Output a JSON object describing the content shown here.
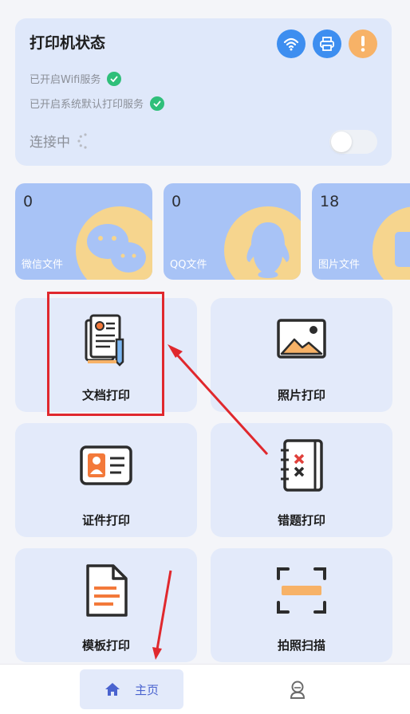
{
  "status": {
    "title": "打印机状态",
    "wifi_service": "已开启Wifi服务",
    "default_print_service": "已开启系统默认打印服务",
    "connecting": "连接中",
    "icons": [
      "wifi-icon",
      "printer-icon",
      "warning-icon"
    ],
    "toggle_on": false
  },
  "stats": [
    {
      "count": "0",
      "label": "微信文件",
      "icon": "wechat-icon"
    },
    {
      "count": "0",
      "label": "QQ文件",
      "icon": "qq-icon"
    },
    {
      "count": "18",
      "label": "图片文件",
      "icon": "image-icon"
    }
  ],
  "functions": [
    {
      "label": "文档打印",
      "icon": "document-icon"
    },
    {
      "label": "照片打印",
      "icon": "photo-icon"
    },
    {
      "label": "证件打印",
      "icon": "id-card-icon"
    },
    {
      "label": "错题打印",
      "icon": "notebook-icon"
    },
    {
      "label": "模板打印",
      "icon": "template-icon"
    },
    {
      "label": "拍照扫描",
      "icon": "scan-icon"
    }
  ],
  "nav": {
    "home_label": "主页",
    "profile_icon": "profile-icon"
  },
  "colors": {
    "accent_blue": "#3d8ef0",
    "warning_orange": "#f7b267",
    "success_green": "#2fbf7a",
    "annotation_red": "#e0282d",
    "stat_card": "#a8c3f6"
  }
}
